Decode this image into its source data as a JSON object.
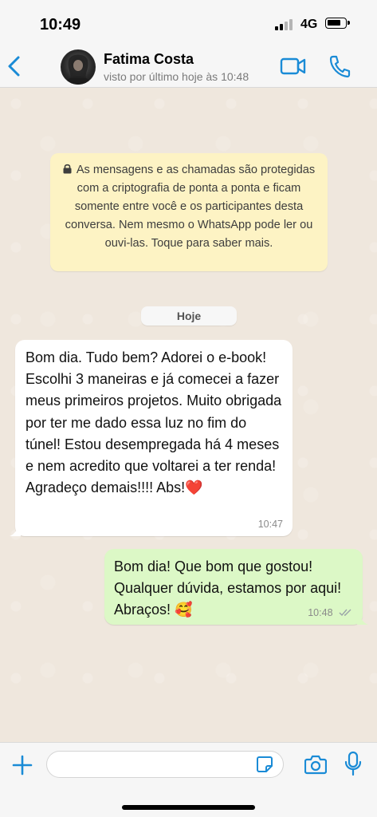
{
  "status_bar": {
    "time": "10:49",
    "network": "4G"
  },
  "header": {
    "back_icon": "chevron-left-icon",
    "contact_name": "Fatima Costa",
    "last_seen": "visto por último hoje às 10:48",
    "video_icon": "video-camera-icon",
    "call_icon": "phone-icon"
  },
  "chat": {
    "encryption_notice": "As mensagens e as chamadas são protegidas com a criptografia de ponta a ponta e ficam somente entre você e os participantes desta conversa. Nem mesmo o WhatsApp pode ler ou ouvi-las. Toque para saber mais.",
    "date_label": "Hoje",
    "messages": [
      {
        "direction": "incoming",
        "text": "Bom dia. Tudo bem? Adorei o e-book! Escolhi 3 maneiras e já comecei a fazer meus primeiros projetos. Muito obrigada por ter me dado essa luz no fim do túnel! Estou desempregada há 4 meses e nem acredito que voltarei a ter renda! Agradeço demais!!!! Abs!❤️",
        "time": "10:47"
      },
      {
        "direction": "outgoing",
        "text": "Bom dia! Que bom que gostou! Qualquer dúvida, estamos por aqui! Abraços! 🥰",
        "time": "10:48",
        "status": "read"
      }
    ]
  },
  "input_bar": {
    "placeholder": "",
    "plus_icon": "plus-icon",
    "sticker_icon": "sticker-icon",
    "camera_icon": "camera-icon",
    "mic_icon": "microphone-icon"
  },
  "colors": {
    "accent": "#1a8bd6",
    "incoming_bubble": "#ffffff",
    "outgoing_bubble": "#dcf8c6",
    "notice_bg": "#fdf3c4",
    "chat_bg": "#efe7dd"
  }
}
